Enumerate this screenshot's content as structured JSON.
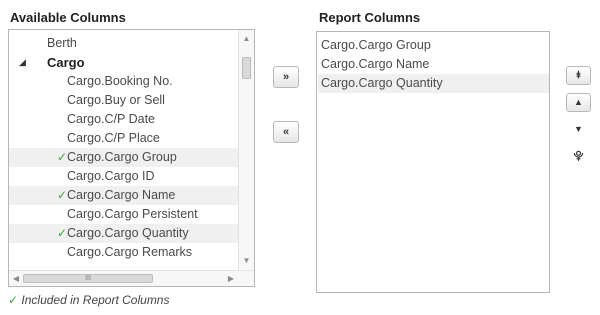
{
  "available": {
    "header": "Available Columns",
    "items": [
      {
        "label": "Berth",
        "checked": false,
        "bold": false,
        "expander": false,
        "selected": false
      },
      {
        "label": "Cargo",
        "checked": false,
        "bold": true,
        "expander": true,
        "selected": false
      },
      {
        "label": "Cargo.Booking No.",
        "checked": false,
        "bold": false,
        "expander": false,
        "selected": false
      },
      {
        "label": "Cargo.Buy or Sell",
        "checked": false,
        "bold": false,
        "expander": false,
        "selected": false
      },
      {
        "label": "Cargo.C/P Date",
        "checked": false,
        "bold": false,
        "expander": false,
        "selected": false
      },
      {
        "label": "Cargo.C/P Place",
        "checked": false,
        "bold": false,
        "expander": false,
        "selected": false
      },
      {
        "label": "Cargo.Cargo Group",
        "checked": true,
        "bold": false,
        "expander": false,
        "selected": true
      },
      {
        "label": "Cargo.Cargo ID",
        "checked": false,
        "bold": false,
        "expander": false,
        "selected": false
      },
      {
        "label": "Cargo.Cargo Name",
        "checked": true,
        "bold": false,
        "expander": false,
        "selected": true
      },
      {
        "label": "Cargo.Cargo Persistent",
        "checked": false,
        "bold": false,
        "expander": false,
        "selected": false
      },
      {
        "label": "Cargo.Cargo Quantity",
        "checked": true,
        "bold": false,
        "expander": false,
        "selected": true
      },
      {
        "label": "Cargo.Cargo Remarks",
        "checked": false,
        "bold": false,
        "expander": false,
        "selected": false
      }
    ],
    "hscroll_thumb": "III"
  },
  "report": {
    "header": "Report Columns",
    "items": [
      {
        "label": "Cargo.Cargo Group",
        "selected": false
      },
      {
        "label": "Cargo.Cargo Name",
        "selected": false
      },
      {
        "label": "Cargo.Cargo Quantity",
        "selected": true
      }
    ]
  },
  "buttons": {
    "add": "»",
    "remove": "«",
    "move_top": "⯒",
    "move_up": "▲",
    "move_down": "▼",
    "move_bottom": "⯓"
  },
  "legend": {
    "check": "✓",
    "text": "Included in Report Columns"
  },
  "glyphs": {
    "check": "✓",
    "expander": "◢"
  }
}
